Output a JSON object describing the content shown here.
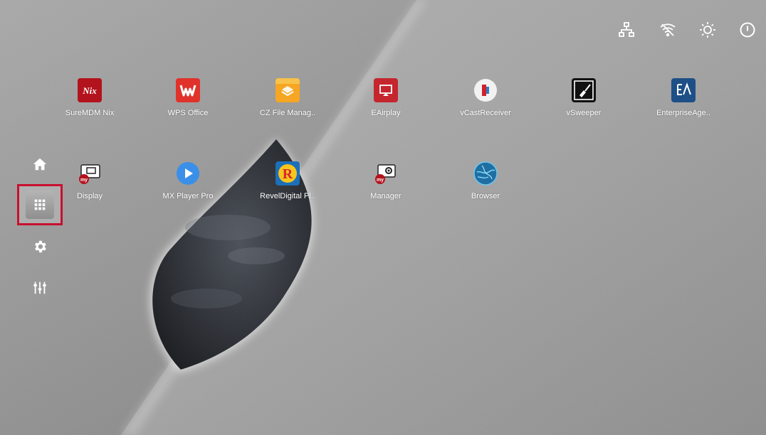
{
  "status_bar": {
    "icons": [
      "network-icon",
      "wifi-off-icon",
      "brightness-icon",
      "power-icon"
    ]
  },
  "sidebar": {
    "items": [
      {
        "name": "home-icon"
      },
      {
        "name": "apps-grid-icon",
        "selected": true
      },
      {
        "name": "settings-icon"
      },
      {
        "name": "equalizer-icon"
      }
    ],
    "highlight_color": "#c8102e"
  },
  "apps": {
    "row1": [
      {
        "label": "SureMDM Nix",
        "icon": "suremdm-nix-icon"
      },
      {
        "label": "WPS Office",
        "icon": "wps-office-icon"
      },
      {
        "label": "CZ File Manag..",
        "icon": "cz-file-manager-icon"
      },
      {
        "label": "EAirplay",
        "icon": "eairplay-icon"
      },
      {
        "label": "vCastReceiver",
        "icon": "vcastreceiver-icon"
      },
      {
        "label": "vSweeper",
        "icon": "vsweeper-icon"
      },
      {
        "label": "EnterpriseAge..",
        "icon": "enterprise-agent-icon"
      }
    ],
    "row2": [
      {
        "label": "Display",
        "icon": "my-display-icon"
      },
      {
        "label": "MX Player Pro",
        "icon": "mx-player-icon"
      },
      {
        "label": "RevelDigital Pl..",
        "icon": "reveldigital-icon"
      },
      {
        "label": "Manager",
        "icon": "my-manager-icon"
      },
      {
        "label": "Browser",
        "icon": "browser-icon"
      }
    ]
  }
}
